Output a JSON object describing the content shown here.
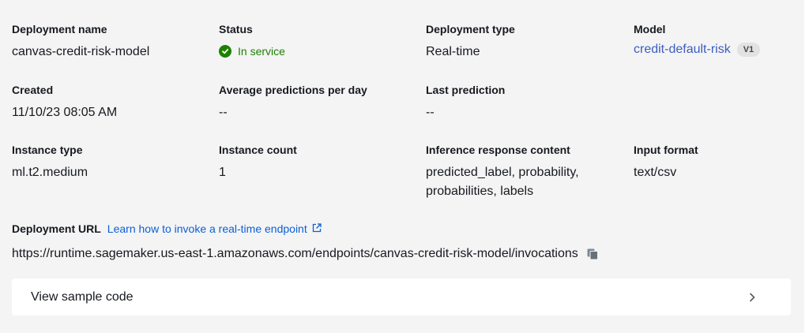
{
  "fields": {
    "deployment_name": {
      "label": "Deployment name",
      "value": "canvas-credit-risk-model"
    },
    "status": {
      "label": "Status",
      "value": "In service",
      "icon": "check-circle-icon",
      "color": "#1d8102"
    },
    "deployment_type": {
      "label": "Deployment type",
      "value": "Real-time"
    },
    "model": {
      "label": "Model",
      "value": "credit-default-risk",
      "version": "V1",
      "link_color": "#3d5cc2"
    },
    "created": {
      "label": "Created",
      "value": "11/10/23 08:05 AM"
    },
    "avg_predictions": {
      "label": "Average predictions per day",
      "value": "--"
    },
    "last_prediction": {
      "label": "Last prediction",
      "value": "--"
    },
    "instance_type": {
      "label": "Instance type",
      "value": "ml.t2.medium"
    },
    "instance_count": {
      "label": "Instance count",
      "value": "1"
    },
    "inference_response": {
      "label": "Inference response content",
      "value": "predicted_label, probability, probabilities, labels"
    },
    "input_format": {
      "label": "Input format",
      "value": "text/csv"
    }
  },
  "deployment_url": {
    "label": "Deployment URL",
    "learn_link": "Learn how to invoke a real-time endpoint",
    "url": "https://runtime.sagemaker.us-east-1.amazonaws.com/endpoints/canvas-credit-risk-model/invocations"
  },
  "sample_code": {
    "label": "View sample code"
  }
}
